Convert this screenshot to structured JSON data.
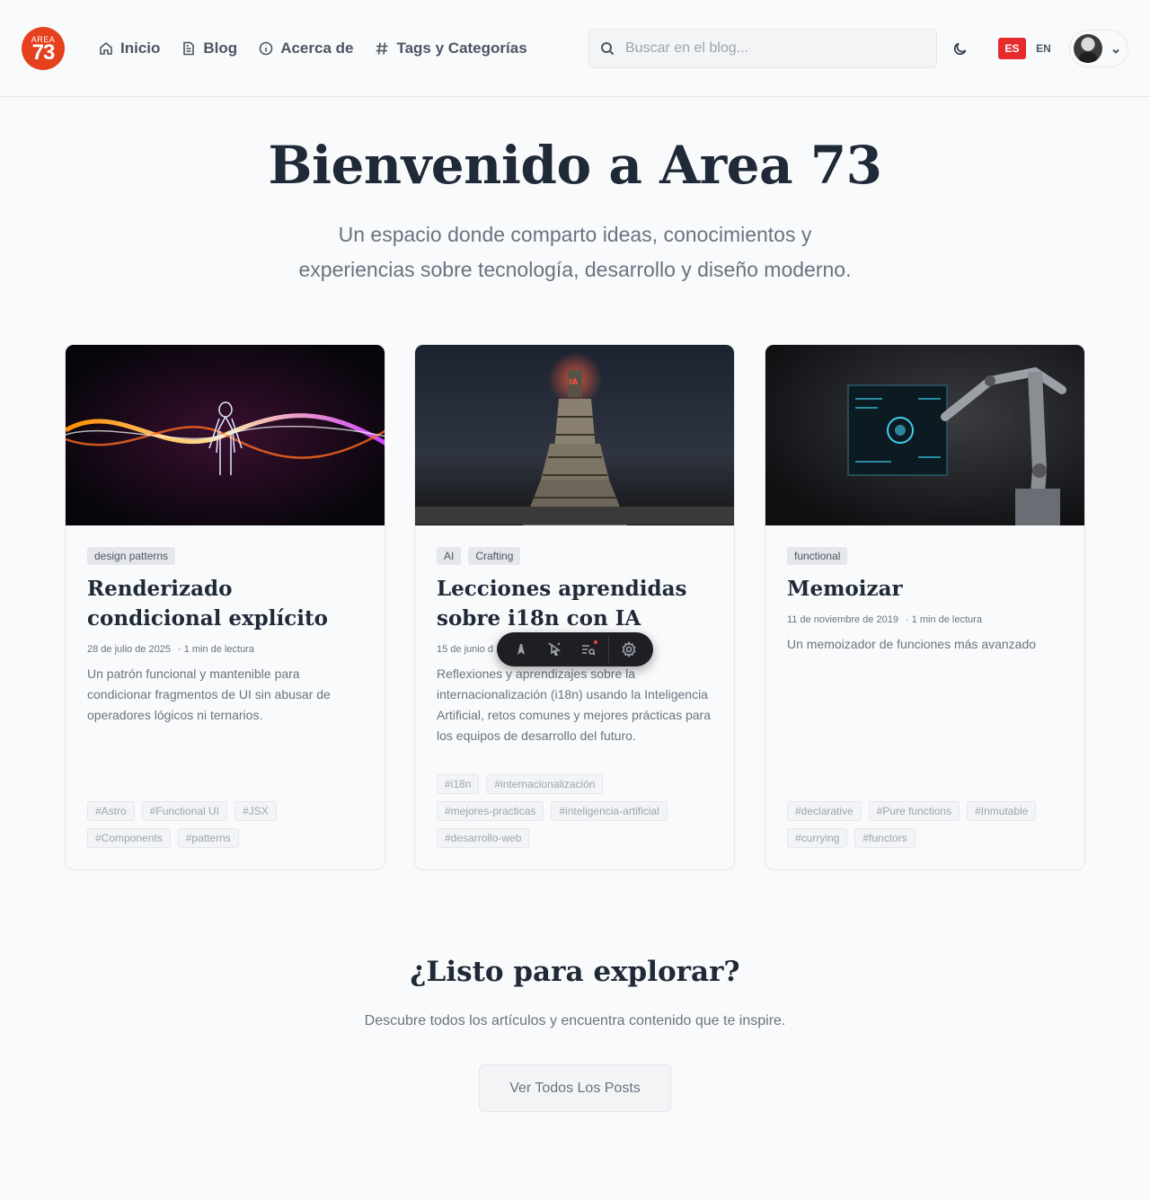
{
  "logo": {
    "small": "AREA",
    "big": "73"
  },
  "nav": [
    {
      "label": "Inicio",
      "icon": "home-icon"
    },
    {
      "label": "Blog",
      "icon": "document-icon"
    },
    {
      "label": "Acerca de",
      "icon": "info-icon"
    },
    {
      "label": "Tags y Categorías",
      "icon": "hash-icon"
    }
  ],
  "search": {
    "placeholder": "Buscar en el blog..."
  },
  "lang": {
    "es": "ES",
    "en": "EN",
    "active": "ES",
    "active_color": "#e52b2b"
  },
  "hero": {
    "title": "Bienvenido a Area 73",
    "subtitle": "Un espacio donde comparto ideas, conocimientos y experiencias sobre tecnología, desarrollo y diseño moderno."
  },
  "posts": [
    {
      "categories": [
        "design patterns"
      ],
      "title": "Renderizado condicional explícito",
      "date": "28 de julio de 2025",
      "read_time": "1 min de lectura",
      "excerpt": "Un patrón funcional y mantenible para condicionar fragmentos de UI sin abusar de operadores lógicos ni ternarios.",
      "tags": [
        "#Astro",
        "#Functional UI",
        "#JSX",
        "#Components",
        "#patterns"
      ]
    },
    {
      "categories": [
        "AI",
        "Crafting"
      ],
      "title": "Lecciones aprendidas sobre i18n con IA",
      "date": "15 de junio d",
      "read_time": "",
      "excerpt": "Reflexiones y aprendizajes sobre la internacionalización (i18n) usando la Inteligencia Artificial, retos comunes y mejores prácticas para los equipos de desarrollo del futuro.",
      "tags": [
        "#i18n",
        "#internacionalización",
        "#mejores-practicas",
        "#inteligencia-artificial",
        "#desarrollo-web"
      ]
    },
    {
      "categories": [
        "functional"
      ],
      "title": "Memoizar",
      "date": "11 de noviembre de 2019",
      "read_time": "1 min de lectura",
      "excerpt": "Un memoizador de funciones más avanzado",
      "tags": [
        "#declarative",
        "#Pure functions",
        "#Inmutable",
        "#currying",
        "#functors"
      ]
    }
  ],
  "cta": {
    "title": "¿Listo para explorar?",
    "subtitle": "Descubre todos los artículos y encuentra contenido que te inspire.",
    "button": "Ver Todos Los Posts"
  },
  "toolbar": {
    "icons": [
      "astro-logo-icon",
      "cursor-inspect-icon",
      "audit-list-icon",
      "settings-gear-icon"
    ]
  }
}
